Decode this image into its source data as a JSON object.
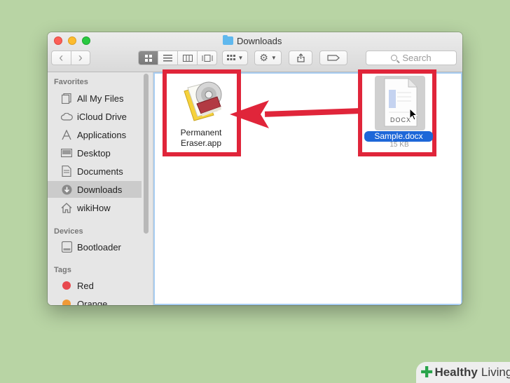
{
  "window": {
    "title": "Downloads"
  },
  "toolbar": {
    "back_icon": "‹",
    "forward_icon": "›",
    "view_icons": "icon-view,list-view,column-view,coverflow-view",
    "arrange_icon": "group-icon",
    "action_icon": "gear-icon",
    "share_icon": "share-icon",
    "tag_icon": "tag-icon",
    "search_placeholder": "Search"
  },
  "sidebar": {
    "favorites_header": "Favorites",
    "favorites": [
      {
        "label": "All My Files",
        "icon": "files-icon"
      },
      {
        "label": "iCloud Drive",
        "icon": "cloud-icon"
      },
      {
        "label": "Applications",
        "icon": "applications-icon"
      },
      {
        "label": "Desktop",
        "icon": "desktop-icon"
      },
      {
        "label": "Documents",
        "icon": "documents-icon"
      },
      {
        "label": "Downloads",
        "icon": "download-icon",
        "active": true
      },
      {
        "label": "wikiHow",
        "icon": "home-icon"
      }
    ],
    "devices_header": "Devices",
    "devices": [
      {
        "label": "Bootloader",
        "icon": "disk-icon"
      }
    ],
    "tags_header": "Tags",
    "tags": [
      {
        "label": "Red",
        "color": "#e8484d"
      },
      {
        "label": "Orange",
        "color": "#f09a37"
      }
    ]
  },
  "files": {
    "app": {
      "name_line1": "Permanent",
      "name_line2": "Eraser.app"
    },
    "doc": {
      "badge": "DOCX",
      "name": "Sample.docx",
      "size": "15 KB"
    }
  },
  "colors": {
    "highlight": "#e0253a",
    "selection": "#1d67d8",
    "background": "#b8d4a4"
  },
  "watermark": {
    "brand_bold": "Healthy",
    "brand_light": "Living"
  }
}
